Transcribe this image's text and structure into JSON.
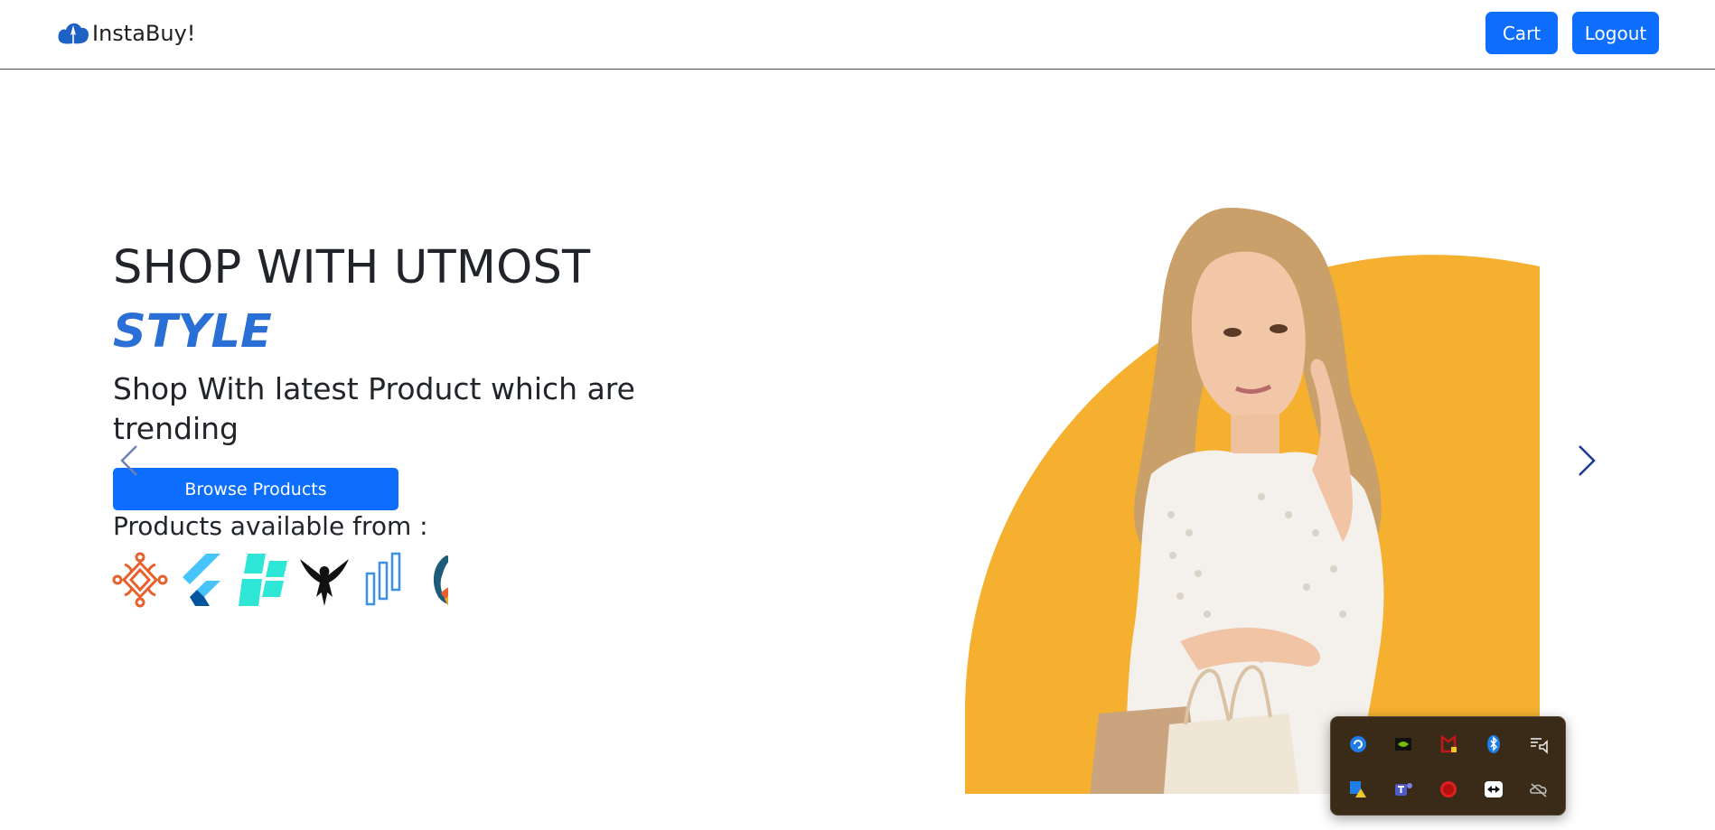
{
  "navbar": {
    "brand": "InstaBuy!",
    "cart_label": "Cart",
    "logout_label": "Logout",
    "accent_color": "#0d6efd"
  },
  "hero": {
    "title": "SHOP WITH UTMOST",
    "accent": "STYLE",
    "subtitle": "Shop With latest Product which are trending",
    "browse_label": "Browse Products",
    "available_label": "Products available from :",
    "accent_color": "#2a6fd6",
    "brand_logos": [
      "orange-ornament-logo",
      "flutter-logo",
      "teal-squares-logo",
      "black-eagle-logo",
      "blue-bars-logo",
      "swirl-bird-logo"
    ]
  },
  "carousel": {
    "prev_icon": "chevron-left-icon",
    "next_icon": "chevron-right-icon"
  },
  "hero_image": {
    "subject": "woman-with-shopping-bags",
    "backdrop_color": "#f4b02e"
  },
  "system_tray": {
    "background": "#3a2a18",
    "icons": [
      "sync-icon",
      "nvidia-icon",
      "mcafee-icon",
      "bluetooth-icon",
      "media-icon",
      "defender-warning-icon",
      "teams-icon",
      "record-icon",
      "teamviewer-icon",
      "onedrive-offline-icon"
    ]
  }
}
